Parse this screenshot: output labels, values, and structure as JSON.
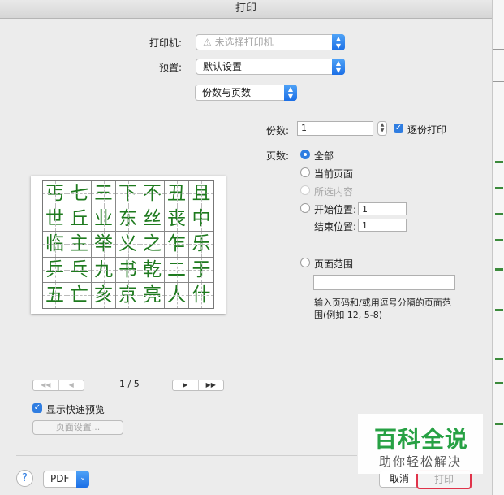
{
  "window": {
    "title": "打印"
  },
  "printer": {
    "label": "打印机:",
    "value": "⚠ 未选择打印机"
  },
  "presets": {
    "label": "预置:",
    "value": "默认设置"
  },
  "section": {
    "value": "份数与页数"
  },
  "copies": {
    "label": "份数:",
    "value": "1",
    "collate_label": "逐份打印",
    "collate_checked": true
  },
  "pages": {
    "label": "页数:",
    "options": [
      {
        "label": "全部",
        "selected": true,
        "enabled": true
      },
      {
        "label": "当前页面",
        "selected": false,
        "enabled": true
      },
      {
        "label": "所选内容",
        "selected": false,
        "enabled": false
      },
      {
        "label": "开始位置:",
        "selected": false,
        "enabled": true
      }
    ],
    "from_value": "1",
    "to_label": "结束位置:",
    "to_value": "1",
    "range_label": "页面范围",
    "range_value": "",
    "range_hint_line1": "输入页码和/或用逗号分隔的页面范",
    "range_hint_line2": "围(例如 12, 5-8)"
  },
  "preview": {
    "rows": [
      [
        "丐",
        "七",
        "三",
        "下",
        "不",
        "丑",
        "且"
      ],
      [
        "世",
        "丘",
        "业",
        "东",
        "丝",
        "丧",
        "中"
      ],
      [
        "临",
        "主",
        "举",
        "义",
        "之",
        "乍",
        "乐"
      ],
      [
        "乒",
        "乓",
        "九",
        "书",
        "乾",
        "二",
        "于"
      ],
      [
        "五",
        "亡",
        "亥",
        "京",
        "亮",
        "人",
        "什"
      ]
    ],
    "page_indicator": "1 / 5",
    "first_icon": "first-page-icon",
    "prev_icon": "prev-page-icon",
    "next_icon": "next-page-icon",
    "last_icon": "last-page-icon",
    "glyph_color": "#1e7a1e"
  },
  "quick_preview": {
    "label": "显示快速预览",
    "checked": true
  },
  "page_setup": {
    "label": "页面设置..."
  },
  "footer": {
    "help": "?",
    "pdf": "PDF",
    "cancel": "取消",
    "print": "打印"
  },
  "watermark": {
    "brand": "百科全说",
    "slogan": "助你轻松解决"
  },
  "colors": {
    "accent": "#2f7de1",
    "highlight": "#e0334a",
    "brand_green": "#1f9e3e"
  }
}
